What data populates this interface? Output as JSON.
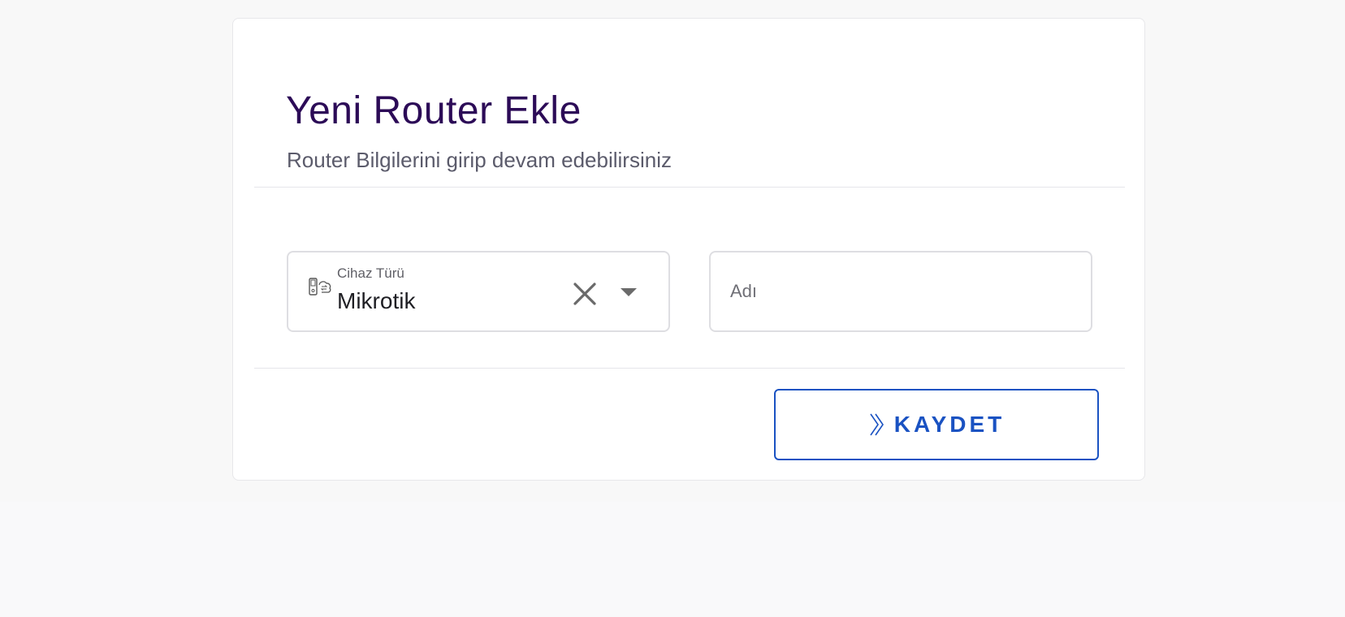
{
  "form": {
    "title": "Yeni Router Ekle",
    "subtitle": "Router Bilgilerini girip devam edebilirsiniz",
    "device_type": {
      "label": "Cihaz Türü",
      "value": "Mikrotik",
      "icon": "router-device-icon",
      "clear_icon": "close-icon",
      "dropdown_icon": "caret-down-icon"
    },
    "name": {
      "placeholder": "Adı",
      "value": ""
    },
    "save_button": {
      "label": "KAYDET",
      "icon": "double-chevron-right-icon"
    }
  },
  "colors": {
    "title": "#2c0b57",
    "accent": "#1a52c2",
    "subtitle": "#5b5b6b",
    "border": "#dedee2"
  }
}
